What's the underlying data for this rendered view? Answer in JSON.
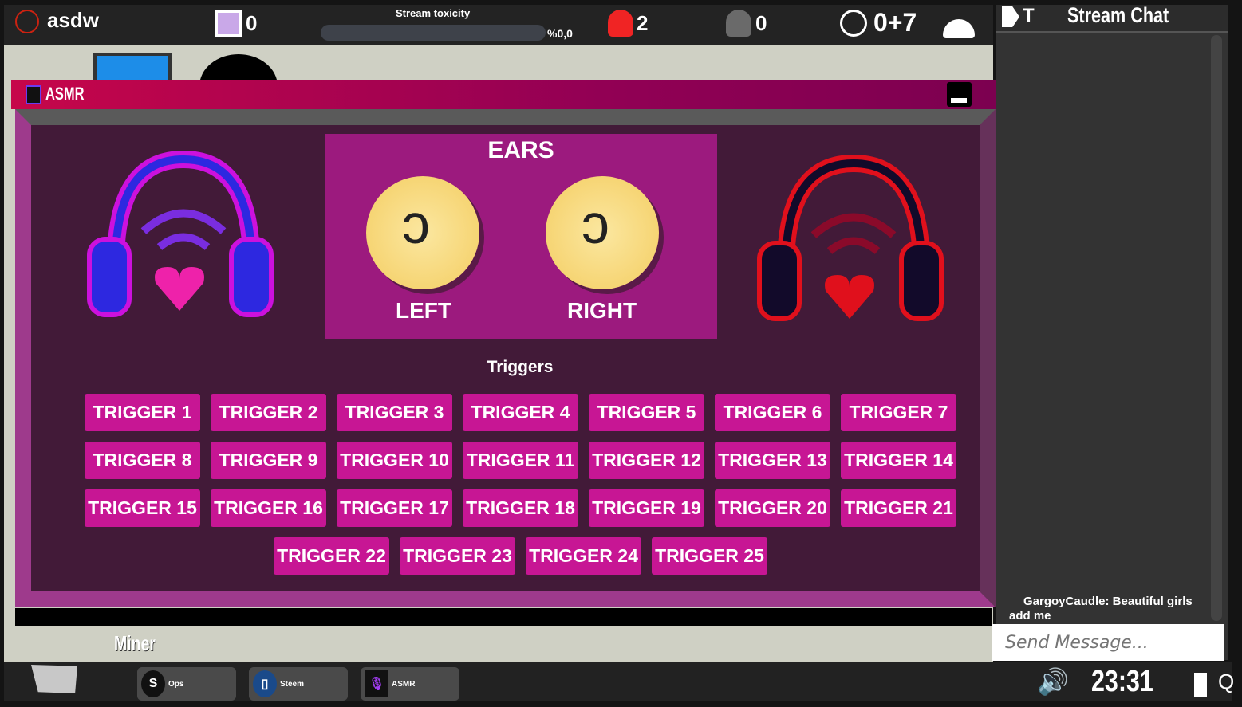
{
  "topbar": {
    "username": "asdw",
    "cat_count": "0",
    "toxicity_label": "Stream toxicity",
    "toxicity_value": "%0,0",
    "toxicity_fraction": 0,
    "red_users": "2",
    "grey_users": "0",
    "timer": "0+7"
  },
  "chat": {
    "title_prefix": "T",
    "title": "Stream Chat",
    "messages": [
      {
        "text": "GargoyCaudle: Beautiful girls add me"
      }
    ],
    "input_placeholder": "Send Message..."
  },
  "game": {
    "label": "Miner"
  },
  "window": {
    "title": "ASMR",
    "ears_title": "EARS",
    "left": "LEFT",
    "right": "RIGHT",
    "triggers_title": "Triggers",
    "triggers": [
      "TRIGGER 1",
      "TRIGGER 2",
      "TRIGGER 3",
      "TRIGGER 4",
      "TRIGGER 5",
      "TRIGGER 6",
      "TRIGGER 7",
      "TRIGGER 8",
      "TRIGGER 9",
      "TRIGGER 10",
      "TRIGGER 11",
      "TRIGGER 12",
      "TRIGGER 13",
      "TRIGGER 14",
      "TRIGGER 15",
      "TRIGGER 16",
      "TRIGGER 17",
      "TRIGGER 18",
      "TRIGGER 19",
      "TRIGGER 20",
      "TRIGGER 21",
      "TRIGGER 22",
      "TRIGGER 23",
      "TRIGGER 24",
      "TRIGGER 25"
    ],
    "colors": {
      "trigger": "#c71694",
      "body": "#421a38",
      "ears_panel": "#9c1a7e",
      "headphone_left": "#2d28e0",
      "headphone_right": "#e0101c"
    }
  },
  "taskbar": {
    "apps": [
      {
        "label": "Ops",
        "icon": "ops-icon"
      },
      {
        "label": "Steem",
        "icon": "steem-icon"
      },
      {
        "label": "ASMR",
        "icon": "microphone-icon"
      }
    ],
    "clock": "23:31"
  }
}
